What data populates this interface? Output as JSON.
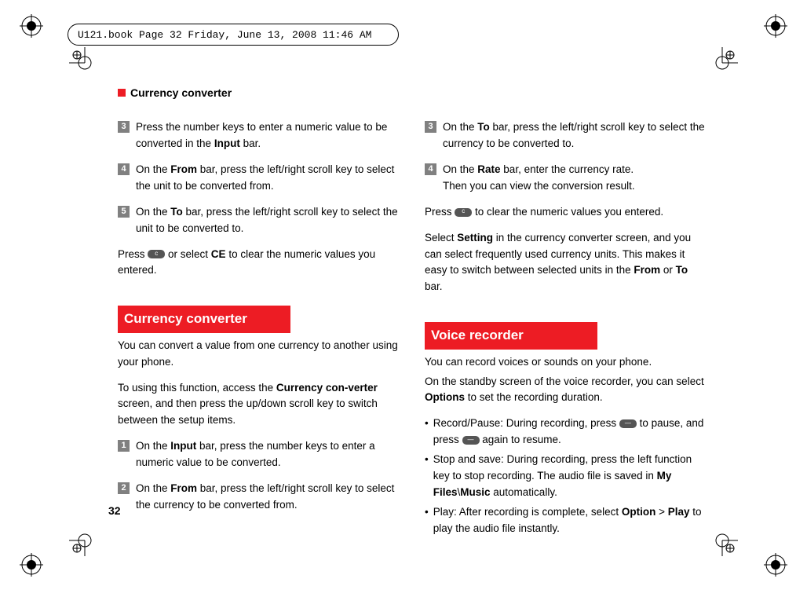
{
  "header": "U121.book  Page 32  Friday, June 13, 2008  11:46 AM",
  "sectionTitle": "Currency converter",
  "pageNumber": "32",
  "left": {
    "step3": {
      "n": "3",
      "t1": "Press the number keys to enter a numeric value to be converted in the ",
      "b1": "Input",
      "t2": " bar."
    },
    "step4": {
      "n": "4",
      "t1": "On the ",
      "b1": "From",
      "t2": " bar, press the left/right scroll key to select the unit to be converted from."
    },
    "step5": {
      "n": "5",
      "t1": "On the ",
      "b1": "To",
      "t2": " bar, press the left/right scroll key to select the unit to be converted to."
    },
    "pressLine": {
      "t1": "Press ",
      "t2": " or select ",
      "b1": "CE",
      "t3": " to clear the numeric values you entered."
    },
    "heading": "Currency converter",
    "intro1": "You can convert a value from one currency to another using your phone.",
    "intro2a": "To using this function, access the ",
    "intro2b": "Currency con-verter",
    "intro2c": " screen, and then press the up/down scroll key to switch between the setup items.",
    "cstep1": {
      "n": "1",
      "t1": "On the ",
      "b1": "Input",
      "t2": " bar, press the number keys to enter a numeric value to be converted."
    },
    "cstep2": {
      "n": "2",
      "t1": "On the ",
      "b1": "From",
      "t2": " bar, press the left/right scroll key to select the currency to be converted from."
    }
  },
  "right": {
    "step3": {
      "n": "3",
      "t1": "On the ",
      "b1": "To",
      "t2": " bar, press the left/right scroll key to select the currency to be converted to."
    },
    "step4": {
      "n": "4",
      "t1": "On the ",
      "b1": "Rate",
      "t2": " bar, enter the currency rate.",
      "t3": "Then you can view the conversion result."
    },
    "pressLine": {
      "t1": "Press ",
      "t2": " to clear the numeric values you entered."
    },
    "settingPara": {
      "t1": "Select ",
      "b1": "Setting",
      "t2": " in the currency converter screen, and you can select frequently used currency units. This makes it easy to switch between selected units in the ",
      "b2": "From",
      "t3": " or ",
      "b3": "To",
      "t4": " bar."
    },
    "heading": "Voice recorder",
    "vr1": "You can record voices or sounds on your phone.",
    "vr2a": "On the standby screen of the voice recorder, you can select ",
    "vr2b": "Options",
    "vr2c": " to set the recording duration.",
    "b1": {
      "t1": "Record/Pause:  During recording, press ",
      "t2": " to pause, and press ",
      "t3": " again to resume."
    },
    "b2": {
      "t1": "Stop and save: During recording, press the left function key to stop recording. The audio file is saved in ",
      "b1": "My Files",
      "t2": "\\",
      "b2": "Music",
      "t3": " automatically."
    },
    "b3": {
      "t1": "Play: After recording is complete, select ",
      "b1": "Option",
      "t2": " > ",
      "b2": "Play",
      "t3": " to play the audio file instantly."
    }
  }
}
